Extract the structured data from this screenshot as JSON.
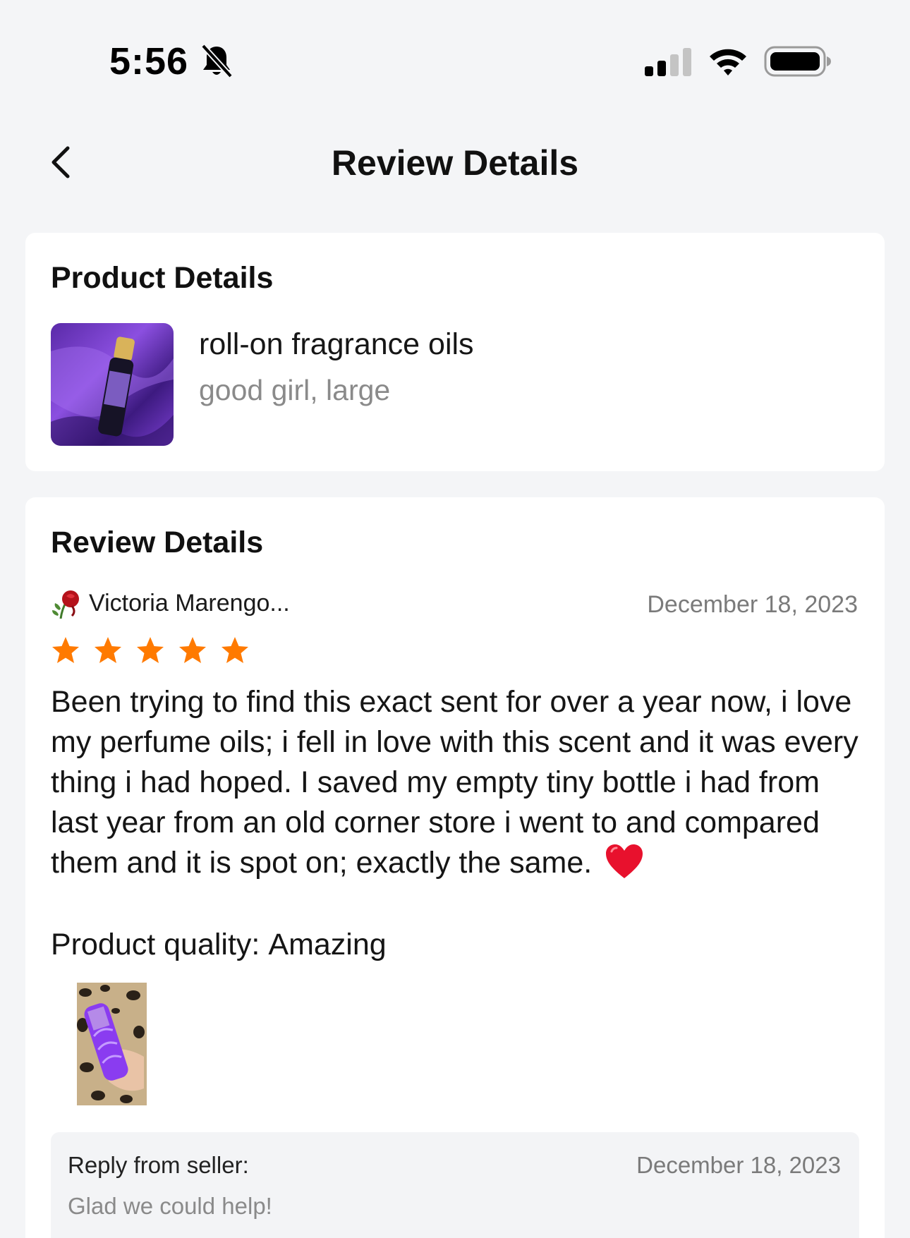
{
  "status_bar": {
    "time": "5:56",
    "icons": [
      "bell-slash-icon",
      "cellular-signal-icon",
      "wifi-icon",
      "battery-icon"
    ]
  },
  "nav": {
    "title": "Review Details",
    "back_icon": "chevron-left-icon"
  },
  "product_details": {
    "heading": "Product Details",
    "product_name": "roll-on fragrance oils",
    "variant": "good girl, large",
    "image": "product-thumbnail"
  },
  "review_details": {
    "heading": "Review Details",
    "reviewer_name": "Victoria Marengo...",
    "reviewer_avatar": "wilted-rose-icon",
    "date": "December 18, 2023",
    "rating": 5,
    "rating_max": 5,
    "text": "Been trying to find this exact sent for over a year now, i love my perfume oils; i fell in love with this scent and it was every thing i had hoped. I saved my empty tiny bottle i had from last year from an old corner store i went to and compared them and it is spot on; exactly the same.",
    "emoji": "red-heart-icon",
    "quality_label": "Product quality:",
    "quality_value": "Amazing",
    "photo": "review-photo"
  },
  "seller_reply": {
    "label": "Reply from seller:",
    "date": "December 18, 2023",
    "text": "Glad we could help!"
  },
  "colors": {
    "background": "#f4f5f7",
    "card": "#ffffff",
    "star": "#ff7a00",
    "muted_text": "#8a8a8a",
    "reply_bg": "#f3f4f6"
  }
}
